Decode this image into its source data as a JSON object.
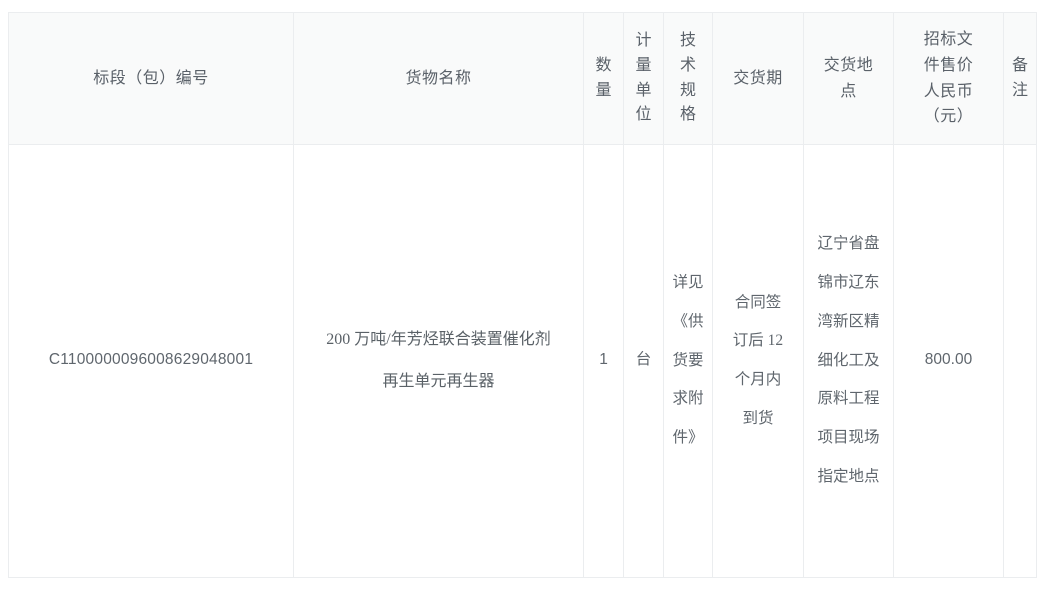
{
  "table": {
    "columns": [
      {
        "key": "code",
        "label": "标段（包）编号",
        "stacked": false
      },
      {
        "key": "name",
        "label": "货物名称",
        "stacked": false
      },
      {
        "key": "qty",
        "label": "数量",
        "stacked": true
      },
      {
        "key": "unit",
        "label": "计量单位",
        "stacked": true
      },
      {
        "key": "spec",
        "label": "技术规格",
        "stacked": true
      },
      {
        "key": "period",
        "label": "交货期",
        "stacked": false
      },
      {
        "key": "place",
        "label": "交货地点",
        "stacked": false
      },
      {
        "key": "price",
        "label": "招标文件售价人民币（元）",
        "stacked": false
      },
      {
        "key": "remark",
        "label": "备注",
        "stacked": true
      }
    ],
    "header": {
      "code": "标段（包）编号",
      "name": "货物名称",
      "qty_lines": [
        "数",
        "量"
      ],
      "unit_lines": [
        "计",
        "量",
        "单",
        "位"
      ],
      "spec_lines": [
        "技",
        "术",
        "规",
        "格"
      ],
      "period": "交货期",
      "place_lines": [
        "交货地",
        "点"
      ],
      "price_lines": [
        "招标文",
        "件售价",
        "人民币",
        "（元）"
      ],
      "remark_lines": [
        "备",
        "注"
      ]
    },
    "rows": [
      {
        "code": "C1100000096008629048001",
        "name_lines": [
          "200 万吨/年芳烃联合装置催化剂",
          "再生单元再生器"
        ],
        "qty": "1",
        "unit": "台",
        "spec_lines": [
          "详见",
          "《供",
          "货要",
          "求附",
          "件》"
        ],
        "period_lines": [
          "合同签",
          "订后 12",
          "个月内",
          "到货"
        ],
        "place_lines": [
          "辽宁省盘",
          "锦市辽东",
          "湾新区精",
          "细化工及",
          "原料工程",
          "项目现场",
          "指定地点"
        ],
        "price": "800.00",
        "remark": ""
      }
    ]
  },
  "style": {
    "border_color": "#ebedef",
    "header_bg": "#f9fafa",
    "text_color": "#5f666d",
    "page_bg": "#ffffff"
  }
}
